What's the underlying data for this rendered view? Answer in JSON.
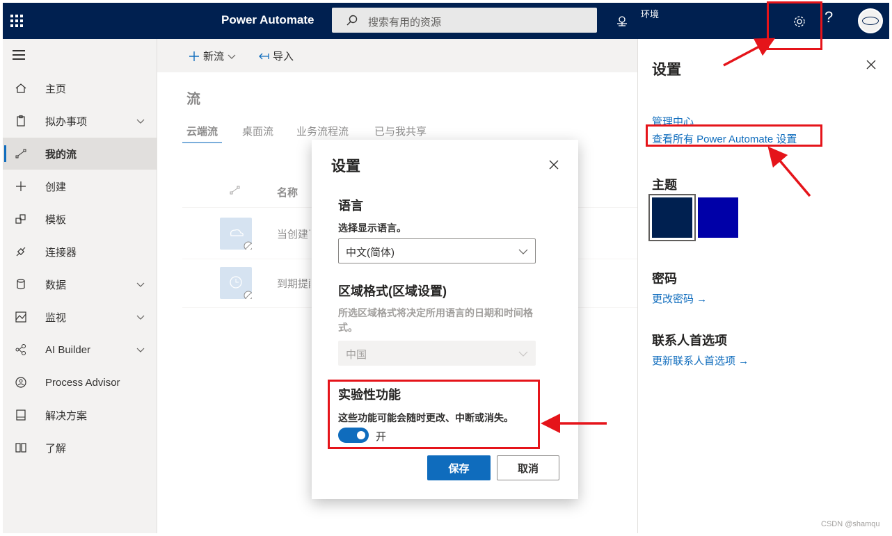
{
  "topbar": {
    "app_name": "Power Automate",
    "search_placeholder": "搜索有用的资源",
    "env_label": "环境",
    "help_label": "?",
    "bg_color": "#002050"
  },
  "leftnav": {
    "items": [
      {
        "label": "主页",
        "icon": "home-icon"
      },
      {
        "label": "拟办事项",
        "icon": "clipboard-icon",
        "chevron": true
      },
      {
        "label": "我的流",
        "icon": "flow-icon",
        "active": true
      },
      {
        "label": "创建",
        "icon": "plus-icon"
      },
      {
        "label": "模板",
        "icon": "template-icon"
      },
      {
        "label": "连接器",
        "icon": "connector-icon"
      },
      {
        "label": "数据",
        "icon": "database-icon",
        "chevron": true
      },
      {
        "label": "监视",
        "icon": "monitor-icon",
        "chevron": true
      },
      {
        "label": "AI Builder",
        "icon": "ai-builder-icon",
        "chevron": true
      },
      {
        "label": "Process Advisor",
        "icon": "process-advisor-icon"
      },
      {
        "label": "解决方案",
        "icon": "solutions-icon"
      },
      {
        "label": "了解",
        "icon": "learn-icon"
      }
    ]
  },
  "commandbar": {
    "new_flow": "新流",
    "import": "导入"
  },
  "main": {
    "title": "流",
    "tabs": [
      "云端流",
      "桌面流",
      "业务流程流",
      "已与我共享"
    ],
    "col_name": "名称",
    "rows": [
      {
        "name": "当创建了"
      },
      {
        "name": "到期提醒"
      }
    ]
  },
  "settings_panel": {
    "title": "设置",
    "admin_center": "管理中心",
    "view_all": "查看所有 Power Automate 设置",
    "theme_heading": "主题",
    "themes": [
      "#002050",
      "#0000a8"
    ],
    "password_heading": "密码",
    "change_password": "更改密码 →",
    "contact_heading": "联系人首选项",
    "update_contact": "更新联系人首选项 →"
  },
  "dialog": {
    "title": "设置",
    "language_heading": "语言",
    "language_label": "选择显示语言。",
    "language_value": "中文(简体)",
    "region_heading": "区域格式(区域设置)",
    "region_label": "所选区域格式将决定所用语言的日期和时间格式。",
    "region_value": "中国",
    "experimental_heading": "实验性功能",
    "experimental_label": "这些功能可能会随时更改、中断或消失。",
    "toggle_label": "开",
    "toggle_on": true,
    "save": "保存",
    "cancel": "取消"
  },
  "watermark": "CSDN @shamqu",
  "annotation_color": "#e5141a"
}
